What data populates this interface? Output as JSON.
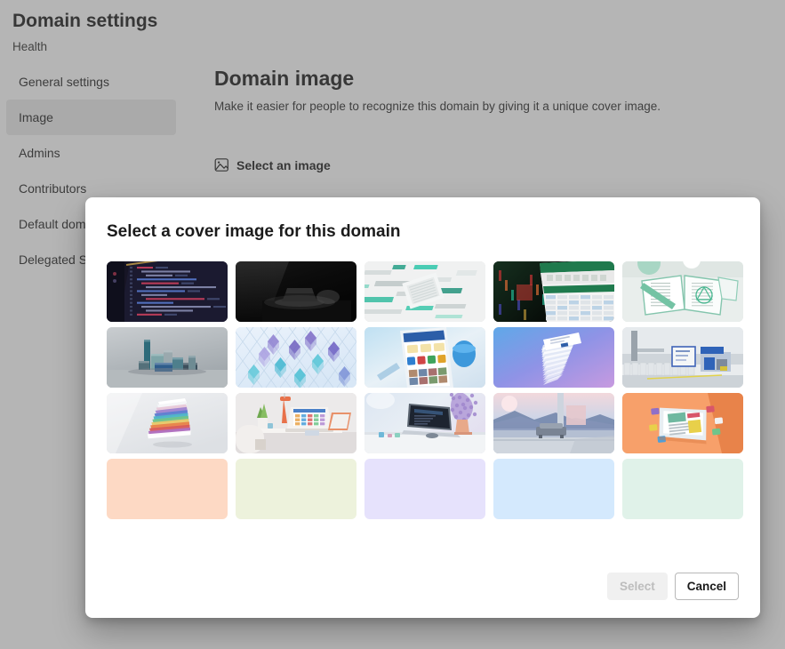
{
  "page": {
    "title": "Domain settings",
    "subtitle": "Health"
  },
  "sidebar": {
    "items": [
      {
        "label": "General settings",
        "selected": false
      },
      {
        "label": "Image",
        "selected": true
      },
      {
        "label": "Admins",
        "selected": false
      },
      {
        "label": "Contributors",
        "selected": false
      },
      {
        "label": "Default domain",
        "selected": false
      },
      {
        "label": "Delegated Settings",
        "selected": false
      }
    ]
  },
  "main": {
    "section_title": "Domain image",
    "section_description": "Make it easier for people to recognize this domain by giving it a unique cover image.",
    "select_image_label": "Select an image",
    "select_image_icon": "image-picture-icon"
  },
  "dialog": {
    "title": "Select a cover image for this domain",
    "buttons": {
      "select_label": "Select",
      "select_disabled": true,
      "cancel_label": "Cancel"
    },
    "tiles": [
      {
        "id": "tile-code-editor",
        "kind": "photo",
        "alt": "Dark code editor on a monitor"
      },
      {
        "id": "tile-dark-desk",
        "kind": "photo",
        "alt": "Dark desk with spotlight on device"
      },
      {
        "id": "tile-teal-circuit",
        "kind": "photo",
        "alt": "Abstract teal and white circuit pattern"
      },
      {
        "id": "tile-spreadsheet",
        "kind": "photo",
        "alt": "Spreadsheet app on dark background"
      },
      {
        "id": "tile-notebook",
        "kind": "photo",
        "alt": "Open notebook with green accents"
      },
      {
        "id": "tile-blocks",
        "kind": "photo",
        "alt": "Teal and grey 3D blocks"
      },
      {
        "id": "tile-crystal-cubes",
        "kind": "photo",
        "alt": "Purple and teal crystal cubes"
      },
      {
        "id": "tile-phone-app",
        "kind": "photo",
        "alt": "Phone showing an app interface"
      },
      {
        "id": "tile-gradient-cards",
        "kind": "photo",
        "alt": "Stacked card on blue purple gradient"
      },
      {
        "id": "tile-office-printer",
        "kind": "photo",
        "alt": "Office shelf with printer and monitor"
      },
      {
        "id": "tile-paper-stack",
        "kind": "photo",
        "alt": "Stack of colorful papers"
      },
      {
        "id": "tile-home-desk",
        "kind": "photo",
        "alt": "Bright home office desk with laptop"
      },
      {
        "id": "tile-laptop-lavender",
        "kind": "photo",
        "alt": "Laptop on desk with lavender plant"
      },
      {
        "id": "tile-window-view",
        "kind": "photo",
        "alt": "Sofa by window with mountain view"
      },
      {
        "id": "tile-orange-isometric",
        "kind": "photo",
        "alt": "Isometric workspace on orange background"
      },
      {
        "id": "tile-swatch-peach",
        "kind": "color",
        "color": "#FDD9C4",
        "alt": "Peach color swatch"
      },
      {
        "id": "tile-swatch-green",
        "kind": "color",
        "color": "#EDF2DC",
        "alt": "Pale green color swatch"
      },
      {
        "id": "tile-swatch-lavender",
        "kind": "color",
        "color": "#E6E2FC",
        "alt": "Lavender color swatch"
      },
      {
        "id": "tile-swatch-blue",
        "kind": "color",
        "color": "#D4E9FD",
        "alt": "Light blue color swatch"
      },
      {
        "id": "tile-swatch-mint",
        "kind": "color",
        "color": "#E0F2E9",
        "alt": "Mint color swatch"
      }
    ]
  }
}
